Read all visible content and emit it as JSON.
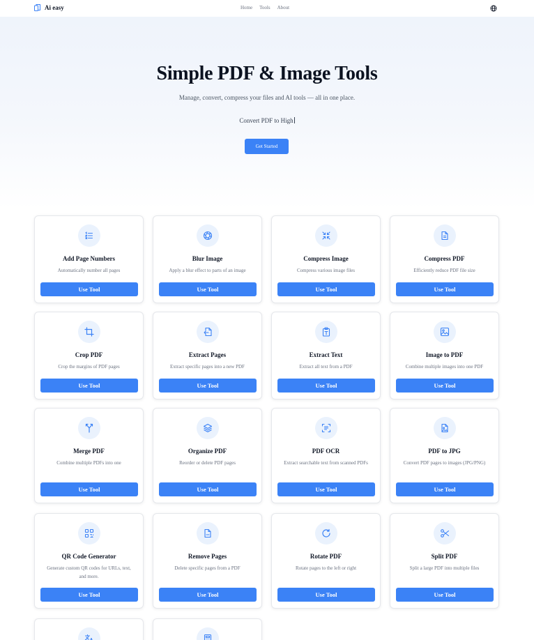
{
  "nav": {
    "brand": "Ai easy",
    "links": [
      "Home",
      "Tools",
      "About"
    ],
    "logo_icon": "pages-icon",
    "language_icon": "globe-icon"
  },
  "hero": {
    "title": "Simple PDF & Image Tools",
    "subtitle": "Manage, convert, compress your files and AI tools — all in one place.",
    "typing_text": "Convert PDF to High",
    "cta_label": "Get Started"
  },
  "colors": {
    "accent": "#3b82f6",
    "icon_bg": "#eaf2fd"
  },
  "tools": [
    {
      "title": "Add Page Numbers",
      "description": "Automatically number all pages",
      "button": "Use Tool",
      "icon": "list-numbered-icon"
    },
    {
      "title": "Blur Image",
      "description": "Apply a blur effect to parts of an image",
      "button": "Use Tool",
      "icon": "aperture-icon"
    },
    {
      "title": "Compress Image",
      "description": "Compress various image files",
      "button": "Use Tool",
      "icon": "shrink-arrows-icon"
    },
    {
      "title": "Compress PDF",
      "description": "Efficiently reduce PDF file size",
      "button": "Use Tool",
      "icon": "file-text-icon"
    },
    {
      "title": "Crop PDF",
      "description": "Crop the margins of PDF pages",
      "button": "Use Tool",
      "icon": "crop-icon"
    },
    {
      "title": "Extract Pages",
      "description": "Extract specific pages into a new PDF",
      "button": "Use Tool",
      "icon": "file-export-icon"
    },
    {
      "title": "Extract Text",
      "description": "Extract all text from a PDF",
      "button": "Use Tool",
      "icon": "clipboard-text-icon"
    },
    {
      "title": "Image to PDF",
      "description": "Combine multiple images into one PDF",
      "button": "Use Tool",
      "icon": "image-icon"
    },
    {
      "title": "Merge PDF",
      "description": "Combine multiple PDFs into one",
      "button": "Use Tool",
      "icon": "merge-icon"
    },
    {
      "title": "Organize PDF",
      "description": "Reorder or delete PDF pages",
      "button": "Use Tool",
      "icon": "layers-icon"
    },
    {
      "title": "PDF OCR",
      "description": "Extract searchable text from scanned PDFs",
      "button": "Use Tool",
      "icon": "scan-text-icon"
    },
    {
      "title": "PDF to JPG",
      "description": "Convert PDF pages to images (JPG/PNG)",
      "button": "Use Tool",
      "icon": "file-image-icon"
    },
    {
      "title": "QR Code Generator",
      "description": "Generate custom QR codes for URLs, text, and more.",
      "button": "Use Tool",
      "icon": "qr-code-icon"
    },
    {
      "title": "Remove Pages",
      "description": "Delete specific pages from a PDF",
      "button": "Use Tool",
      "icon": "file-minus-icon"
    },
    {
      "title": "Rotate PDF",
      "description": "Rotate pages to the left or right",
      "button": "Use Tool",
      "icon": "rotate-icon"
    },
    {
      "title": "Split PDF",
      "description": "Split a large PDF into multiple files",
      "button": "Use Tool",
      "icon": "scissors-icon"
    },
    {
      "icon": "translate-icon"
    },
    {
      "icon": "calculator-icon"
    }
  ]
}
